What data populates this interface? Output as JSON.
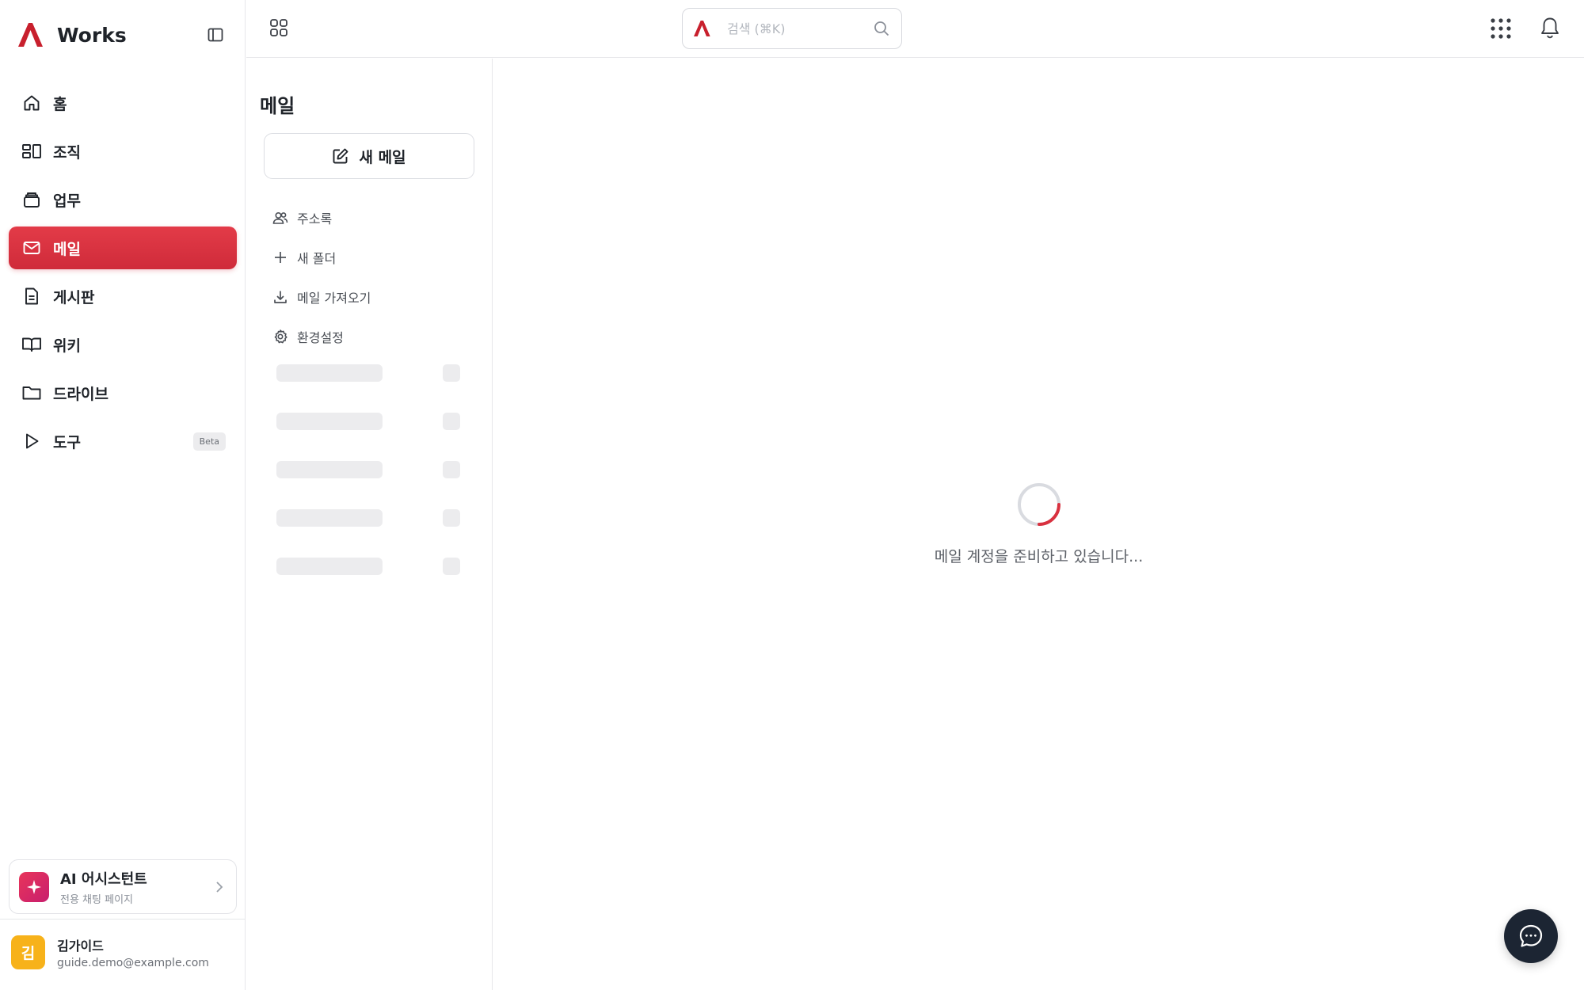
{
  "brand": {
    "name": "Works",
    "color": "#c8202d"
  },
  "sidebar": {
    "items": [
      {
        "label": "홈",
        "icon": "home-icon"
      },
      {
        "label": "조직",
        "icon": "org-icon"
      },
      {
        "label": "업무",
        "icon": "tasks-icon"
      },
      {
        "label": "메일",
        "icon": "mail-icon",
        "active": true
      },
      {
        "label": "게시판",
        "icon": "document-icon"
      },
      {
        "label": "위키",
        "icon": "book-icon"
      },
      {
        "label": "드라이브",
        "icon": "folder-icon"
      },
      {
        "label": "도구",
        "icon": "play-icon",
        "badge": "Beta"
      }
    ],
    "active_color": "#d9313f"
  },
  "ai_assistant": {
    "title": "AI 어시스턴트",
    "subtitle": "전용 채팅 페이지"
  },
  "user": {
    "initial": "김",
    "name": "김가이드",
    "email": "guide.demo@example.com",
    "avatar_color": "#f7b21a"
  },
  "search": {
    "placeholder": "검색 (⌘K)"
  },
  "mail_panel": {
    "title": "메일",
    "new_mail_label": "새 메일",
    "menu": [
      {
        "label": "주소록",
        "icon": "contacts-icon"
      },
      {
        "label": "새 폴더",
        "icon": "plus-icon"
      },
      {
        "label": "메일 가져오기",
        "icon": "download-icon"
      },
      {
        "label": "환경설정",
        "icon": "settings-icon"
      }
    ]
  },
  "main": {
    "loading_text": "메일 계정을 준비하고 있습니다..."
  }
}
